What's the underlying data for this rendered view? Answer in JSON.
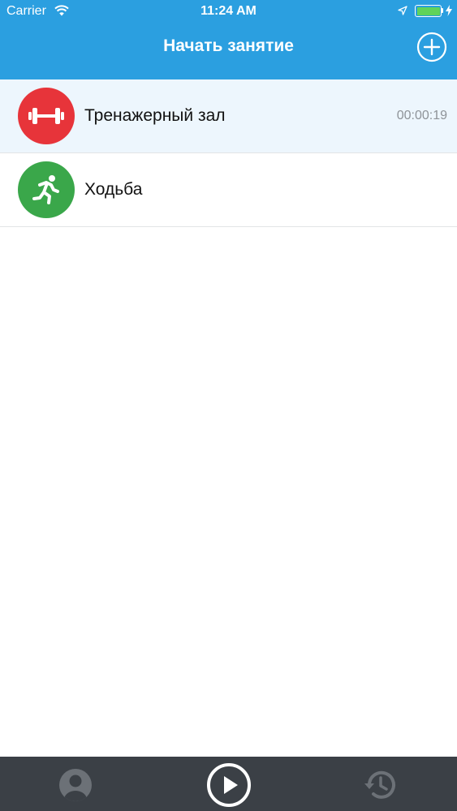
{
  "status_bar": {
    "carrier": "Carrier",
    "time": "11:24 AM",
    "icons": [
      "wifi-icon",
      "location-icon",
      "battery-icon",
      "charging-icon"
    ]
  },
  "nav": {
    "title": "Начать занятие",
    "add_icon": "plus-circle-icon"
  },
  "activities": [
    {
      "label": "Тренажерный зал",
      "time": "00:00:19",
      "icon": "dumbbell-icon",
      "color": "#e7343a",
      "active": true
    },
    {
      "label": "Ходьба",
      "time": "",
      "icon": "running-icon",
      "color": "#3aa74a",
      "active": false
    }
  ],
  "tabbar": {
    "items": [
      "profile-icon",
      "play-icon",
      "history-icon"
    ]
  },
  "colors": {
    "header": "#2b9fe0",
    "tabbar": "#3b4046",
    "active_row": "#edf6fd",
    "battery": "#5fd35b"
  }
}
